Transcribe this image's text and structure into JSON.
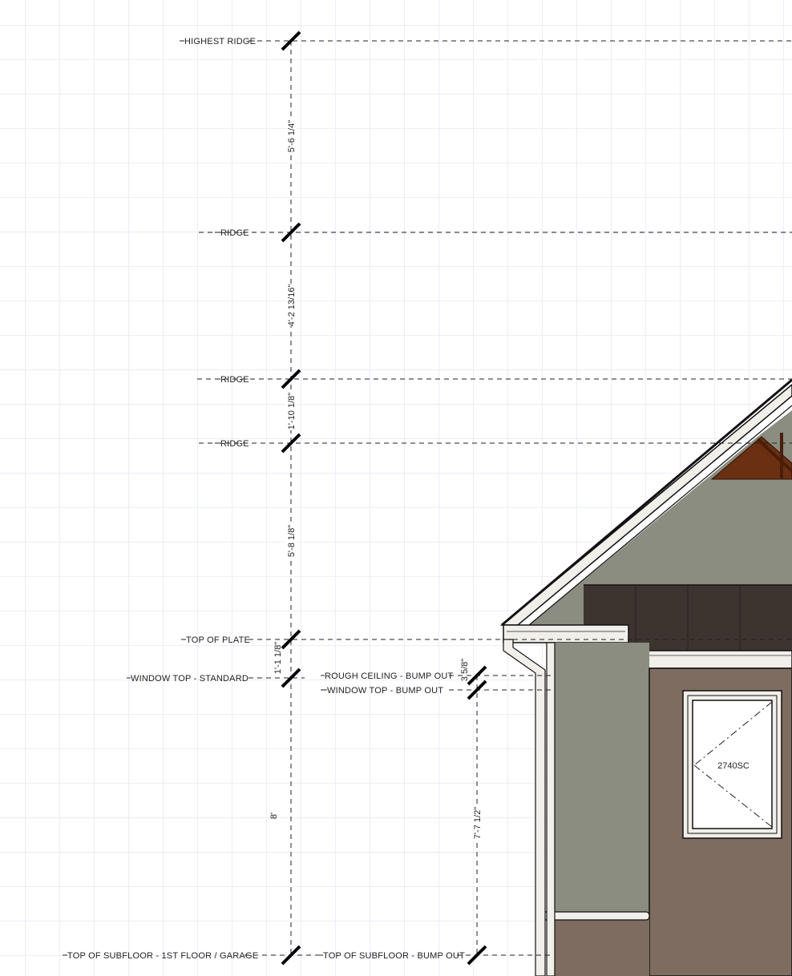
{
  "elevation_markers": [
    {
      "id": "highest-ridge",
      "label": "HIGHEST RIDGE"
    },
    {
      "id": "ridge-1",
      "label": "RIDGE"
    },
    {
      "id": "ridge-2",
      "label": "RIDGE"
    },
    {
      "id": "ridge-3",
      "label": "RIDGE"
    },
    {
      "id": "top-of-plate",
      "label": "TOP OF PLATE"
    },
    {
      "id": "window-top-standard",
      "label": "WINDOW TOP - STANDARD"
    },
    {
      "id": "rough-ceiling-bump-out",
      "label": "ROUGH CEILING - BUMP OUT"
    },
    {
      "id": "window-top-bump-out",
      "label": "WINDOW TOP - BUMP OUT"
    },
    {
      "id": "top-of-subfloor-1st",
      "label": "TOP OF SUBFLOOR - 1ST FLOOR / GARAGE"
    },
    {
      "id": "top-of-subfloor-bump-out",
      "label": "TOP OF SUBFLOOR - BUMP OUT"
    }
  ],
  "dimensions": {
    "highest_ridge_to_ridge": "5'-6 1/4\"",
    "ridge_to_ridge": "4'-2 13/16\"",
    "ridge_to_ridge_small": "1'-10 1/8\"",
    "ridge_to_top_of_plate": "5'-8 1/8\"",
    "plate_to_window_top": "1'-1 1/8\"",
    "window_top_to_subfloor": "8'",
    "rough_ceiling_to_window_top": "3 5/8\"",
    "bump_out_window_to_subfloor": "7'-7 1/2\""
  },
  "window": {
    "tag": "2740SC"
  },
  "colors": {
    "grid": "#d9dcef",
    "siding_green": "#8a8d80",
    "siding_brown": "#7d6c5f",
    "roof_shadow": "#3d3430",
    "timber": "#6b2f12",
    "trim": "#f1efe9"
  }
}
